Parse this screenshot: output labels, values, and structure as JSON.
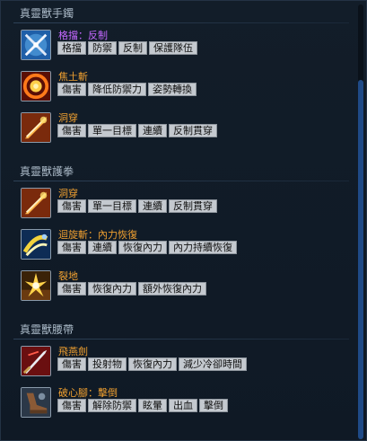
{
  "colors": {
    "purple_skill": "#c468ff",
    "orange_skill": "#f0a030",
    "tag_bg": "#c4c9cf",
    "accent_scroll": "#1f4a86"
  },
  "sections": [
    {
      "title": "真靈獸手鐲",
      "skills": [
        {
          "name": "格擋：反制",
          "icon": "crossed-swords-icon",
          "tags": [
            "格擋",
            "防禦",
            "反制",
            "保護隊伍"
          ]
        },
        {
          "name": "焦土斬",
          "icon": "fire-ring-icon",
          "tags": [
            "傷害",
            "降低防禦力",
            "姿勢轉換"
          ]
        },
        {
          "name": "洞穿",
          "icon": "pierce-icon",
          "tags": [
            "傷害",
            "單一目標",
            "連續",
            "反制貫穿"
          ]
        }
      ]
    },
    {
      "title": "真靈獸護拳",
      "skills": [
        {
          "name": "洞穿",
          "icon": "pierce-icon",
          "tags": [
            "傷害",
            "單一目標",
            "連續",
            "反制貫穿"
          ]
        },
        {
          "name": "迴旋斬：內力恢復",
          "icon": "spin-slash-icon",
          "tags": [
            "傷害",
            "連續",
            "恢復內力",
            "內力持續恢復"
          ]
        },
        {
          "name": "裂地",
          "icon": "ground-crack-icon",
          "tags": [
            "傷害",
            "恢復內力",
            "額外恢復內力"
          ]
        }
      ]
    },
    {
      "title": "真靈獸腰帶",
      "skills": [
        {
          "name": "飛燕劍",
          "icon": "flying-sword-icon",
          "tags": [
            "傷害",
            "投射物",
            "恢復內力",
            "減少冷卻時間"
          ]
        },
        {
          "name": "破心腳：擊倒",
          "icon": "kick-icon",
          "tags": [
            "傷害",
            "解除防禦",
            "眩暈",
            "出血",
            "擊倒"
          ]
        }
      ]
    }
  ]
}
